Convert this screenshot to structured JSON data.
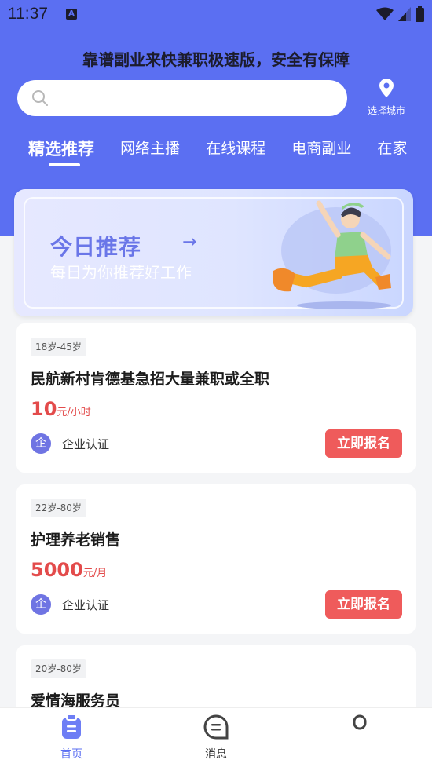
{
  "status_bar": {
    "time": "11:37",
    "notif_letter": "A"
  },
  "slogan": "靠谱副业来快兼职极速版，安全有保障",
  "search": {
    "placeholder": ""
  },
  "city": {
    "label": "选择城市"
  },
  "tabs": [
    "精选推荐",
    "网络主播",
    "在线课程",
    "电商副业",
    "在家"
  ],
  "banner": {
    "title": "今日推荐",
    "subtitle": "每日为你推荐好工作",
    "arrow": "→"
  },
  "jobs": [
    {
      "age": "18岁-45岁",
      "title": "民航新村肯德基急招大量兼职或全职",
      "pay": "10",
      "unit": "元/小时",
      "verify": "企业认证",
      "verify_icon": "企",
      "action": "立即报名"
    },
    {
      "age": "22岁-80岁",
      "title": "护理养老销售",
      "pay": "5000",
      "unit": "元/月",
      "verify": "企业认证",
      "verify_icon": "企",
      "action": "立即报名"
    },
    {
      "age": "20岁-80岁",
      "title": "爱情海服务员"
    }
  ],
  "nav": [
    {
      "label": "首页",
      "icon": "home-clipboard-icon"
    },
    {
      "label": "消息",
      "icon": "message-icon"
    },
    {
      "label": "",
      "icon": "profile-icon"
    }
  ],
  "colors": {
    "primary": "#5b6ff2",
    "accent_red": "#ef5b5b",
    "pay_red": "#e34b4b"
  }
}
